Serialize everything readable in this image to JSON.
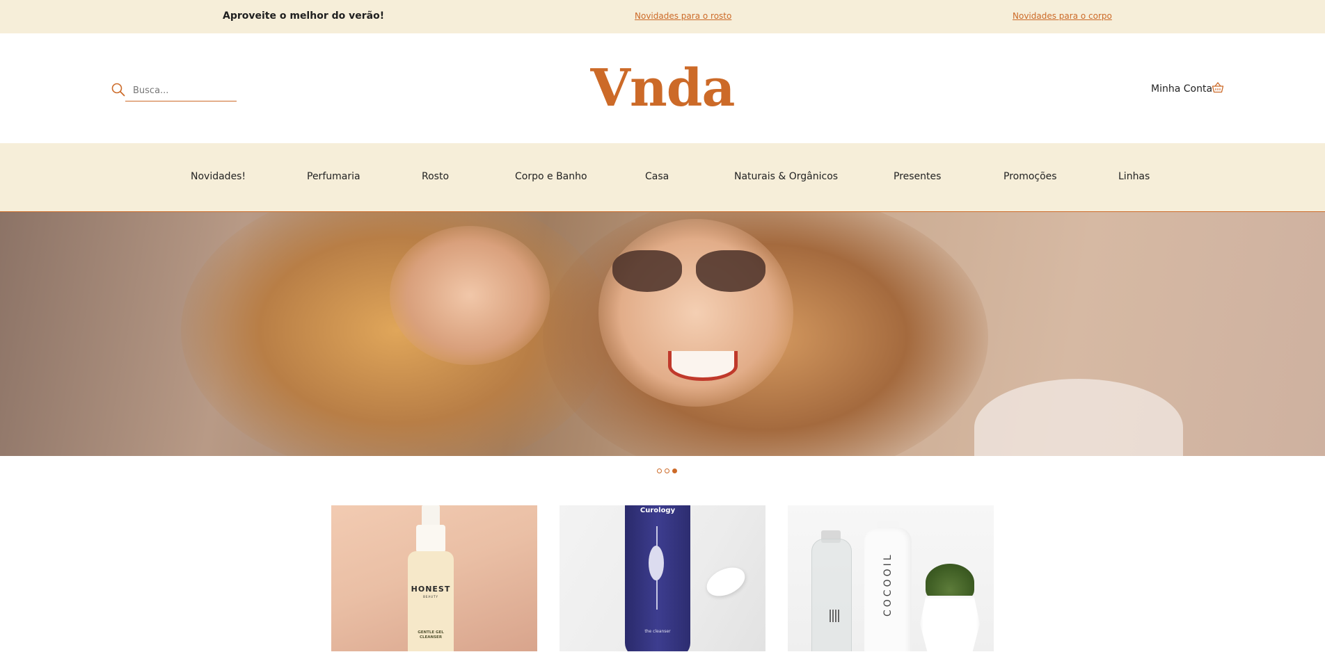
{
  "topbar": {
    "promo": "Aproveite o melhor do verão!",
    "link_face": "Novidades para o rosto",
    "link_body": "Novidades para o corpo"
  },
  "header": {
    "search_placeholder": "Busca...",
    "logo": "Vnda",
    "account_label": "Minha Conta"
  },
  "nav": {
    "items": [
      "Novidades!",
      "Perfumaria",
      "Rosto",
      "Corpo e Banho",
      "Casa",
      "Naturais & Orgânicos",
      "Presentes",
      "Promoções",
      "Linhas"
    ]
  },
  "carousel": {
    "active_index": 2,
    "slide_count": 3
  },
  "products": [
    {
      "brand": "HONEST",
      "brand_sub": "BEAUTY",
      "product_text": "GENTLE GEL CLEANSER"
    },
    {
      "brand": "Curology",
      "product_text": "the cleanser"
    },
    {
      "brand": "COCOOIL"
    }
  ],
  "colors": {
    "accent": "#cc6a28",
    "cream_bg": "#f6eed9"
  }
}
